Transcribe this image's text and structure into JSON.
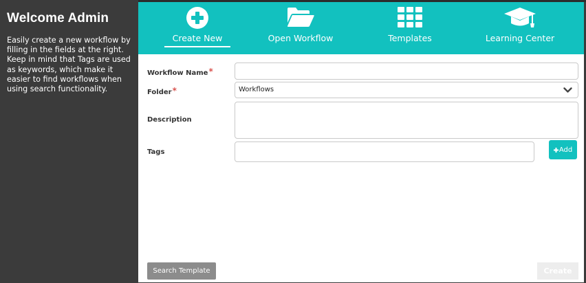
{
  "sidebar": {
    "title": "Welcome Admin",
    "description": "Easily create a new workflow by filling in the fields at the right. Keep in mind that Tags are used as keywords, which make it easier to find workflows when using search functionality."
  },
  "tabs": [
    {
      "label": "Create New",
      "icon": "plus-circle-icon",
      "active": true
    },
    {
      "label": "Open Workflow",
      "icon": "folder-open-icon"
    },
    {
      "label": "Templates",
      "icon": "grid-icon"
    },
    {
      "label": "Learning Center",
      "icon": "graduation-cap-icon"
    }
  ],
  "form": {
    "workflow_name_label": "Workflow Name",
    "workflow_name_value": "",
    "folder_label": "Folder",
    "folder_value": "Workflows",
    "description_label": "Description",
    "description_value": "",
    "tags_label": "Tags",
    "tags_value": "",
    "required_mark": "*",
    "add_label": "Add"
  },
  "footer": {
    "search_template_label": "Search Template",
    "create_label": "Create"
  },
  "colors": {
    "accent": "#12c1bf",
    "sidebar": "#3b3b3b",
    "required": "#d9534f",
    "disabled": "#ededed"
  }
}
